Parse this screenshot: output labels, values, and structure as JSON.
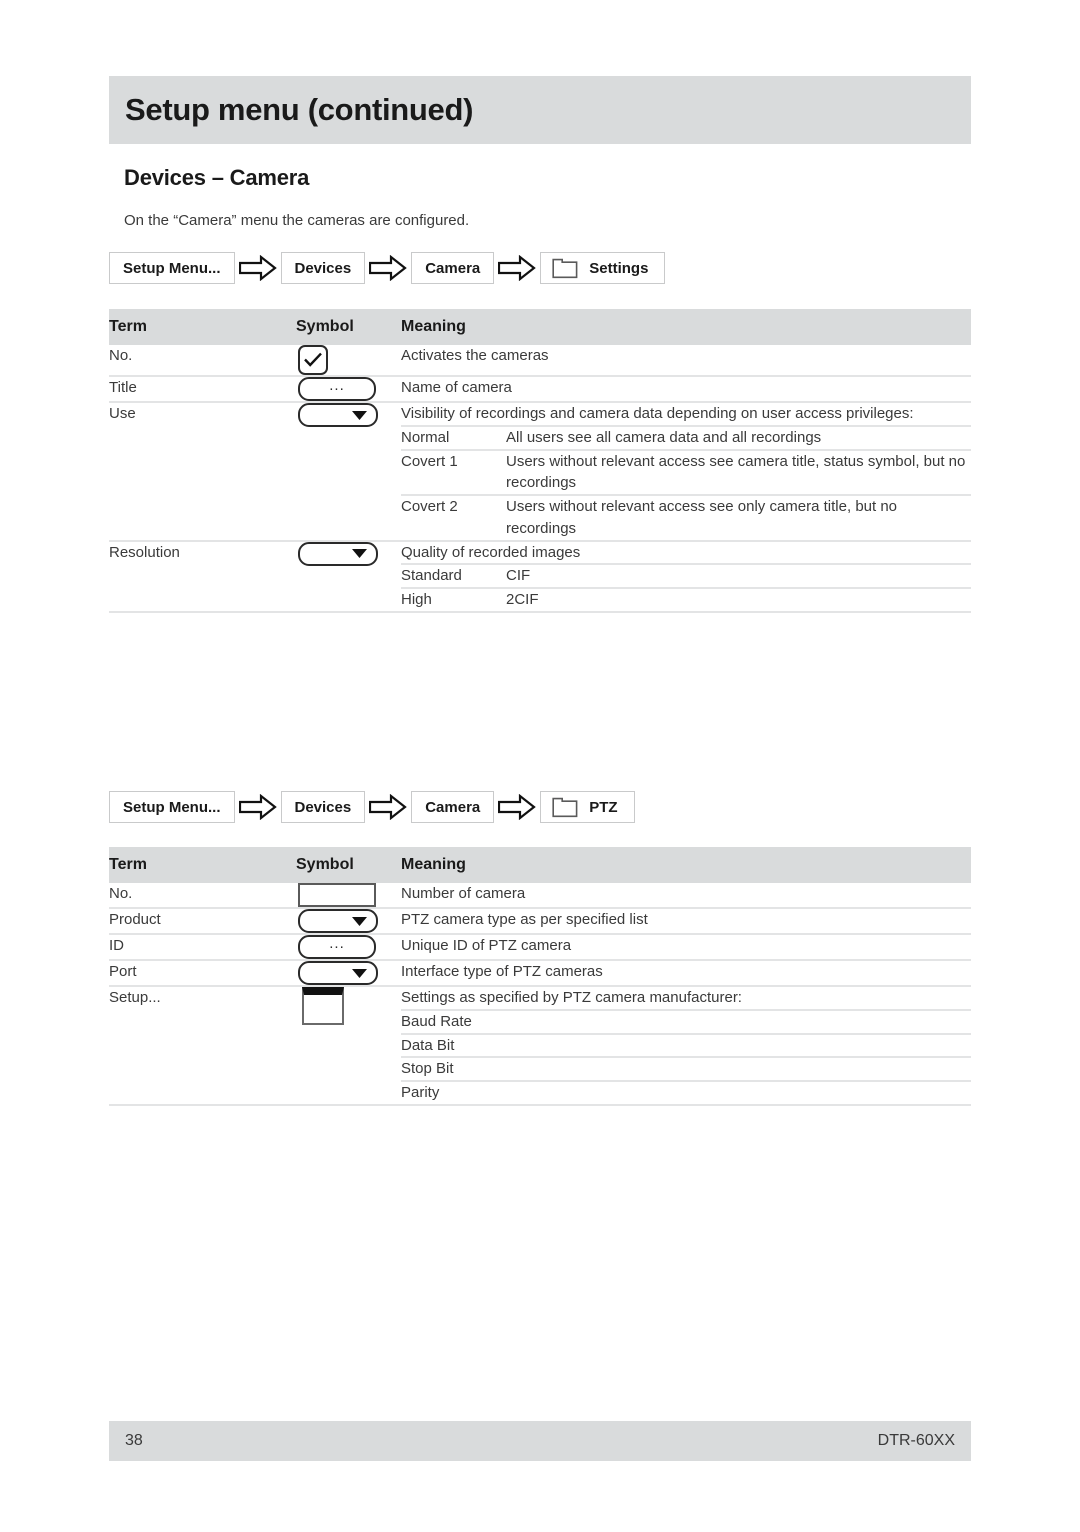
{
  "header": {
    "title": "Setup menu (continued)",
    "band_color": "#d9dbdc"
  },
  "section": {
    "heading": "Devices – Camera",
    "intro": "On the “Camera” menu the cameras are configured."
  },
  "breadcrumbs": [
    {
      "id": "settings",
      "items": [
        {
          "label": "Setup Menu...",
          "icon": null
        },
        {
          "label": "Devices",
          "icon": null
        },
        {
          "label": "Camera",
          "icon": null
        },
        {
          "label": "Settings",
          "icon": "folder-icon"
        }
      ],
      "arrow_icon": "block-arrow-right-icon"
    },
    {
      "id": "ptz",
      "items": [
        {
          "label": "Setup Menu...",
          "icon": null
        },
        {
          "label": "Devices",
          "icon": null
        },
        {
          "label": "Camera",
          "icon": null
        },
        {
          "label": "PTZ",
          "icon": "folder-icon"
        }
      ],
      "arrow_icon": "block-arrow-right-icon"
    }
  ],
  "table_settings": {
    "columns": [
      "Term",
      "Symbol",
      "Meaning"
    ],
    "rows": [
      {
        "term": "No.",
        "symbol": "checkbox-icon",
        "meaning": "Activates the cameras"
      },
      {
        "term": "Title",
        "symbol": "ellipsis-button-icon",
        "meaning": "Name of camera"
      },
      {
        "term": "Use",
        "symbol": "dropdown-icon",
        "meaning_intro": "Visibility of recordings and camera data depending on user access privileges:",
        "sub_rows": [
          {
            "option": "Normal",
            "description": "All users see all camera data and all recordings"
          },
          {
            "option": "Covert 1",
            "description": "Users without relevant access see camera title, status symbol, but no recordings"
          },
          {
            "option": "Covert 2",
            "description": "Users without relevant access see only camera title, but no recordings"
          }
        ]
      },
      {
        "term": "Resolution",
        "symbol": "dropdown-icon",
        "meaning_intro": "Quality of recorded images",
        "sub_rows": [
          {
            "option": "Standard",
            "description": "CIF"
          },
          {
            "option": "High",
            "description": "2CIF"
          }
        ]
      }
    ]
  },
  "table_ptz": {
    "columns": [
      "Term",
      "Symbol",
      "Meaning"
    ],
    "rows": [
      {
        "term": "No.",
        "symbol": "textbox-icon",
        "meaning": "Number of camera"
      },
      {
        "term": "Product",
        "symbol": "dropdown-icon",
        "meaning": "PTZ camera type as per specified list"
      },
      {
        "term": "ID",
        "symbol": "ellipsis-button-icon",
        "meaning": "Unique ID of PTZ camera"
      },
      {
        "term": "Port",
        "symbol": "dropdown-icon",
        "meaning": "Interface type of PTZ cameras"
      },
      {
        "term": "Setup...",
        "symbol": "window-dialog-icon",
        "meaning_intro": "Settings as specified by PTZ camera manufacturer:",
        "sub_rows": [
          {
            "option": "Baud Rate",
            "description": ""
          },
          {
            "option": "Data Bit",
            "description": ""
          },
          {
            "option": "Stop Bit",
            "description": ""
          },
          {
            "option": "Parity",
            "description": ""
          }
        ]
      }
    ]
  },
  "footer": {
    "page_number": "38",
    "model": "DTR-60XX"
  }
}
